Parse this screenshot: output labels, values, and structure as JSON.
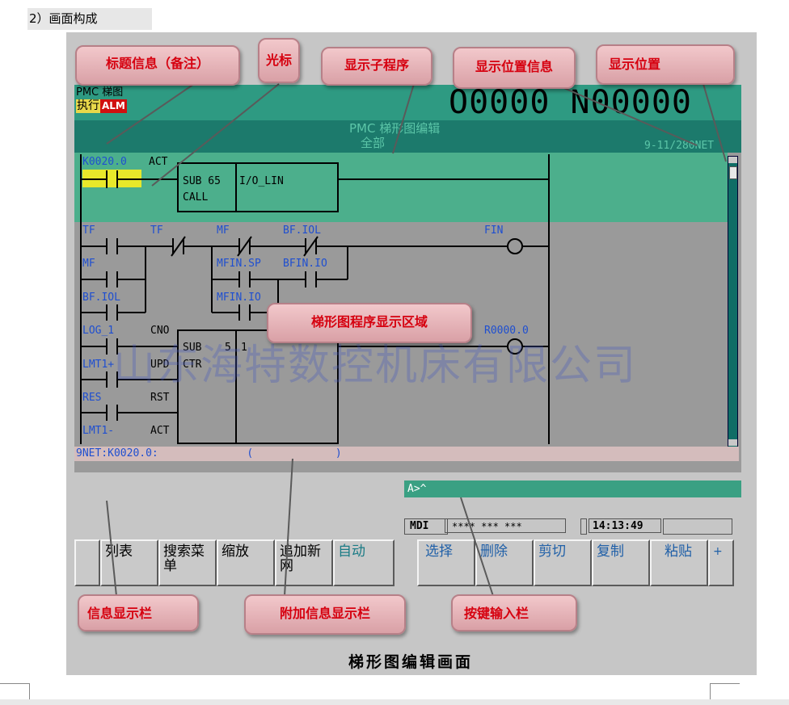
{
  "page": {
    "heading": "2）画面构成",
    "caption": "梯形图编辑画面",
    "watermark": "山东海特数控机床有限公司"
  },
  "screen": {
    "mode_line1": "PMC 梯图",
    "mode_exec": "执行",
    "mode_alm": "ALM",
    "program_display": "O0000 N00000",
    "title_line1": "PMC 梯形图编辑",
    "title_line2": "全部",
    "net_position": "9-11/280NET",
    "message_line": "9NET:K0020.0:              (             )",
    "input_prompt": "A>^",
    "status": {
      "mode": "MDI",
      "stars": "**** *** ***",
      "time": "14:13:49"
    }
  },
  "ladder": {
    "highlight_rung": {
      "contact_address": "K0020.0",
      "contact_label": "ACT",
      "func_line1": "SUB 65",
      "func_line2": "CALL",
      "func_param": "I/O_LIN"
    },
    "labels": {
      "tf1": "TF",
      "tf2": "TF",
      "mf1": "MF",
      "bfiol1": "BF.IOL",
      "fin": "FIN",
      "mf2": "MF",
      "mfinsp": "MFIN.SP",
      "bfinio": "BFIN.IO",
      "bfiol2": "BF.IOL",
      "mfinio": "MFIN.IO",
      "log1": "LOG_1",
      "cno": "CNO",
      "lmt1p": "LMT1+",
      "upd": "UPD",
      "res": "RES",
      "rst": "RST",
      "lmt1m": "LMT1-",
      "act2": "ACT",
      "sub5": "SUB",
      "sub5num": "5",
      "sub5param": "1",
      "ctr": "CTR",
      "coil2": "R0000.0"
    }
  },
  "softkeys": [
    {
      "label": "列表"
    },
    {
      "label": "搜索菜单"
    },
    {
      "label": "缩放"
    },
    {
      "label": "追加新网"
    },
    {
      "label": "自动"
    },
    {
      "label": "选择"
    },
    {
      "label": "删除"
    },
    {
      "label": "剪切"
    },
    {
      "label": "复制"
    },
    {
      "label": "粘贴"
    },
    {
      "label": "+"
    }
  ],
  "callouts": {
    "title_info": "标题信息（备注）",
    "cursor": "光标",
    "subprogram": "显示子程序",
    "position_info": "显示位置信息",
    "position": "显示位置",
    "ladder_area": "梯形图程序显示区域",
    "message_bar": "信息显示栏",
    "extra_message_bar": "附加信息显示栏",
    "key_input_bar": "按键输入栏"
  },
  "colors": {
    "screen_bg": "#9a9a9a",
    "header_teal": "#2e9a82",
    "title_bar": "#1c7a6c",
    "highlight_rung": "#4caf8c",
    "cursor_yellow": "#e8e82a",
    "alarm_red": "#d01010",
    "message_pink": "#d4bcbc",
    "callout_text": "#d6000f"
  }
}
